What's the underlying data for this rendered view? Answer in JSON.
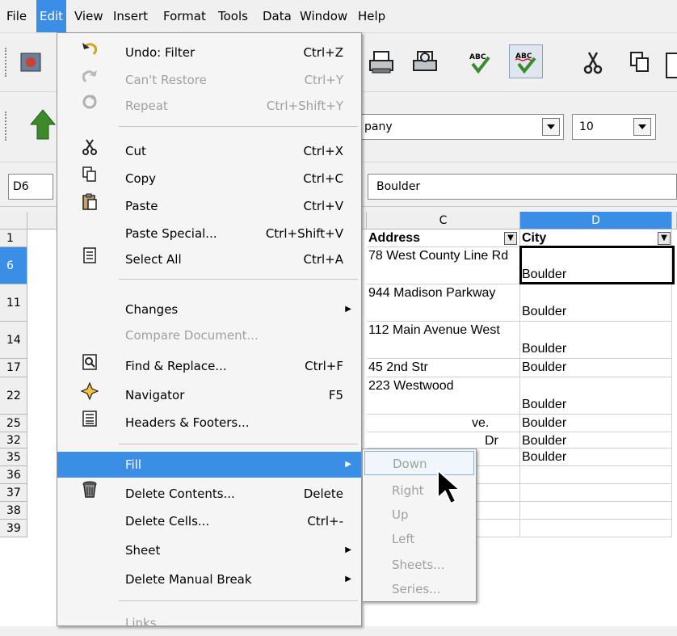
{
  "menubar": {
    "items": [
      {
        "label": "File"
      },
      {
        "label": "Edit"
      },
      {
        "label": "View"
      },
      {
        "label": "Insert"
      },
      {
        "label": "Format"
      },
      {
        "label": "Tools"
      },
      {
        "label": "Data"
      },
      {
        "label": "Window"
      },
      {
        "label": "Help"
      }
    ]
  },
  "toolbar2": {
    "font_name": "pany",
    "font_size": "10"
  },
  "formula": {
    "cell_ref": "D6",
    "content": "Boulder"
  },
  "grid": {
    "columns": [
      "C",
      "D"
    ],
    "header_row": {
      "row": "1",
      "address": "Address",
      "city": "City"
    },
    "rows": [
      {
        "num": "6",
        "address": "78 West County Line Rd",
        "city": "Boulder"
      },
      {
        "num": "11",
        "address": "944 Madison Parkway",
        "city": "Boulder"
      },
      {
        "num": "14",
        "address": "112 Main Avenue West",
        "city": "Boulder"
      },
      {
        "num": "17",
        "address": "45 2nd Str",
        "city": "Boulder"
      },
      {
        "num": "22",
        "address": "223 Westwood",
        "city": "Boulder"
      },
      {
        "num": "25",
        "address": "ve.",
        "city": "Boulder"
      },
      {
        "num": "32",
        "address": "Dr",
        "city": "Boulder"
      },
      {
        "num": "35",
        "address": "",
        "city": "Boulder"
      },
      {
        "num": "36",
        "address": "",
        "city": ""
      },
      {
        "num": "37",
        "address": "",
        "city": ""
      },
      {
        "num": "38",
        "address": "",
        "city": ""
      },
      {
        "num": "39",
        "address": "",
        "city": ""
      }
    ]
  },
  "edit_menu": {
    "items": [
      {
        "icon": "undo-icon",
        "label": "Undo: Filter",
        "accel": "Ctrl+Z"
      },
      {
        "icon": "redo-icon",
        "label": "Can't Restore",
        "accel": "Ctrl+Y"
      },
      {
        "icon": "repeat-icon",
        "label": "Repeat",
        "accel": "Ctrl+Shift+Y"
      },
      {
        "icon": "scissors-icon",
        "label": "Cut",
        "accel": "Ctrl+X"
      },
      {
        "icon": "copy-icon",
        "label": "Copy",
        "accel": "Ctrl+C"
      },
      {
        "icon": "paste-icon",
        "label": "Paste",
        "accel": "Ctrl+V"
      },
      {
        "icon": "",
        "label": "Paste Special...",
        "accel": "Ctrl+Shift+V"
      },
      {
        "icon": "select-all-icon",
        "label": "Select All",
        "accel": "Ctrl+A"
      },
      {
        "icon": "",
        "label": "Changes",
        "accel": ""
      },
      {
        "icon": "",
        "label": "Compare Document...",
        "accel": ""
      },
      {
        "icon": "find-replace-icon",
        "label": "Find & Replace...",
        "accel": "Ctrl+F"
      },
      {
        "icon": "navigator-icon",
        "label": "Navigator",
        "accel": "F5"
      },
      {
        "icon": "headers-footers-icon",
        "label": "Headers & Footers...",
        "accel": ""
      },
      {
        "icon": "",
        "label": "Fill",
        "accel": ""
      },
      {
        "icon": "delete-contents-icon",
        "label": "Delete Contents...",
        "accel": "Delete"
      },
      {
        "icon": "",
        "label": "Delete Cells...",
        "accel": "Ctrl+-"
      },
      {
        "icon": "",
        "label": "Sheet",
        "accel": ""
      },
      {
        "icon": "",
        "label": "Delete Manual Break",
        "accel": ""
      },
      {
        "icon": "",
        "label": "Links...",
        "accel": ""
      }
    ]
  },
  "fill_menu": {
    "items": [
      {
        "label": "Down"
      },
      {
        "label": "Right"
      },
      {
        "label": "Up"
      },
      {
        "label": "Left"
      },
      {
        "label": "Sheets..."
      },
      {
        "label": "Series..."
      }
    ]
  },
  "colors": {
    "highlight": "#3a8ee6",
    "disabled": "#a0a0a0"
  }
}
